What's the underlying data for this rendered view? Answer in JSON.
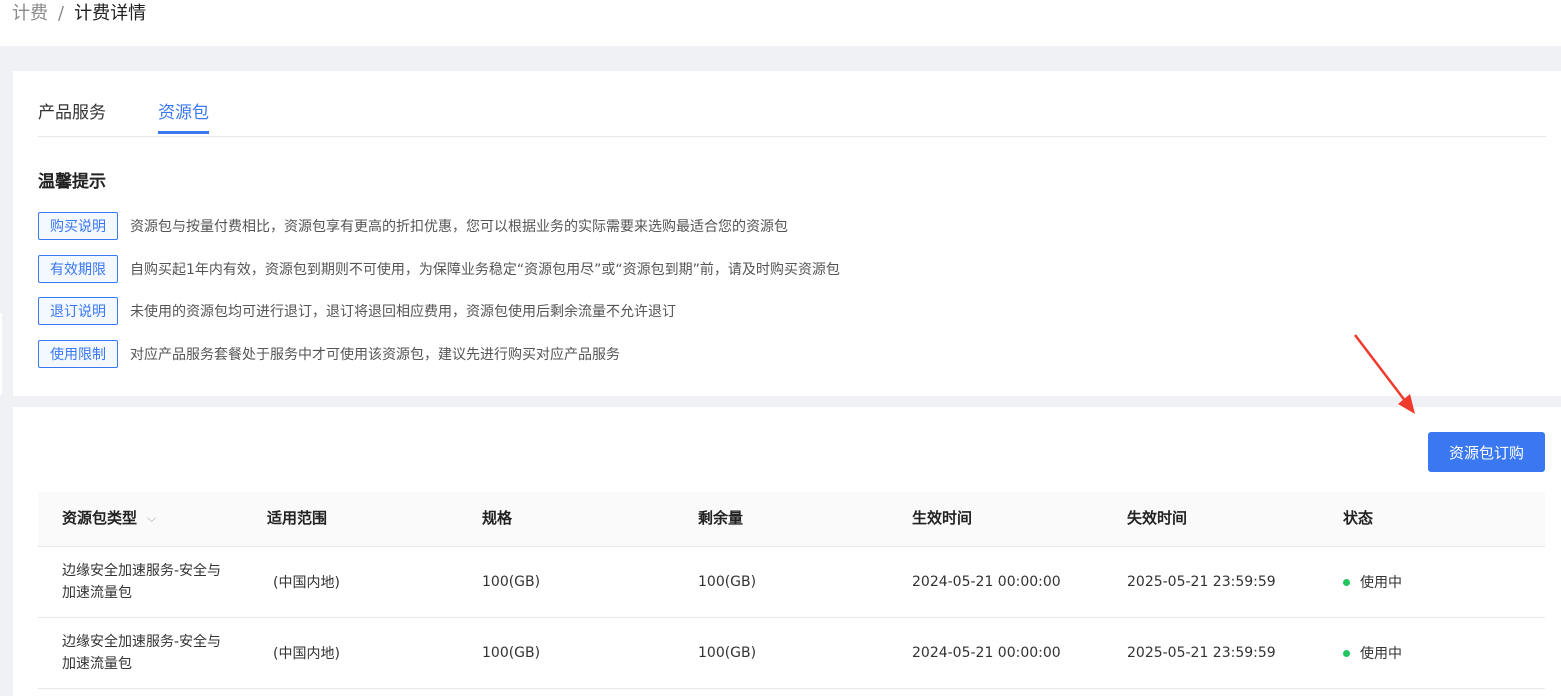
{
  "breadcrumb": {
    "root": "计费",
    "separator": "/",
    "current": "计费详情"
  },
  "tabs": [
    {
      "label": "产品服务",
      "active": false
    },
    {
      "label": "资源包",
      "active": true
    }
  ],
  "tips": {
    "title": "温馨提示",
    "items": [
      {
        "tag": "购买说明",
        "text": "资源包与按量付费相比，资源包享有更高的折扣优惠，您可以根据业务的实际需要来选购最适合您的资源包"
      },
      {
        "tag": "有效期限",
        "text": "自购买起1年内有效，资源包到期则不可使用，为保障业务稳定“资源包用尽”或“资源包到期”前，请及时购买资源包"
      },
      {
        "tag": "退订说明",
        "text": "未使用的资源包均可进行退订，退订将退回相应费用，资源包使用后剩余流量不允许退订"
      },
      {
        "tag": "使用限制",
        "text": "对应产品服务套餐处于服务中才可使用该资源包，建议先进行购买对应产品服务"
      }
    ]
  },
  "actions": {
    "buy_label": "资源包订购"
  },
  "table": {
    "columns": [
      "资源包类型",
      "适用范围",
      "规格",
      "剩余量",
      "生效时间",
      "失效时间",
      "状态"
    ],
    "rows": [
      {
        "type_line1": "边缘安全加速服务-安全与",
        "type_line2": "加速流量包",
        "scope": "(中国内地)",
        "spec": "100(GB)",
        "remaining": "100(GB)",
        "start": "2024-05-21 00:00:00",
        "end": "2025-05-21 23:59:59",
        "status": "使用中"
      },
      {
        "type_line1": "边缘安全加速服务-安全与",
        "type_line2": "加速流量包",
        "scope": "(中国内地)",
        "spec": "100(GB)",
        "remaining": "100(GB)",
        "start": "2024-05-21 00:00:00",
        "end": "2025-05-21 23:59:59",
        "status": "使用中"
      }
    ]
  },
  "colors": {
    "accent": "#3a78f2",
    "status_active": "#22c55e",
    "annotation_arrow": "#f03a2c"
  }
}
